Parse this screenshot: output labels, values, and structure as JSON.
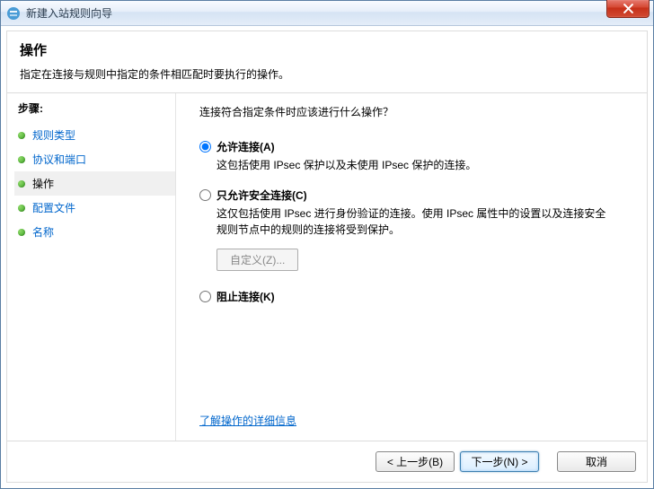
{
  "window": {
    "title": "新建入站规则向导"
  },
  "header": {
    "title": "操作",
    "desc": "指定在连接与规则中指定的条件相匹配时要执行的操作。"
  },
  "sidebar": {
    "stepsLabel": "步骤:",
    "items": [
      {
        "label": "规则类型"
      },
      {
        "label": "协议和端口"
      },
      {
        "label": "操作"
      },
      {
        "label": "配置文件"
      },
      {
        "label": "名称"
      }
    ]
  },
  "main": {
    "prompt": "连接符合指定条件时应该进行什么操作？",
    "options": [
      {
        "label": "允许连接(A)",
        "desc": "这包括使用 IPsec 保护以及未使用 IPsec 保护的连接。"
      },
      {
        "label": "只允许安全连接(C)",
        "desc": "这仅包括使用 IPsec 进行身份验证的连接。使用 IPsec 属性中的设置以及连接安全规则节点中的规则的连接将受到保护。",
        "customize": "自定义(Z)..."
      },
      {
        "label": "阻止连接(K)"
      }
    ],
    "learnMore": "了解操作的详细信息"
  },
  "footer": {
    "back": "< 上一步(B)",
    "next": "下一步(N) >",
    "cancel": "取消"
  }
}
